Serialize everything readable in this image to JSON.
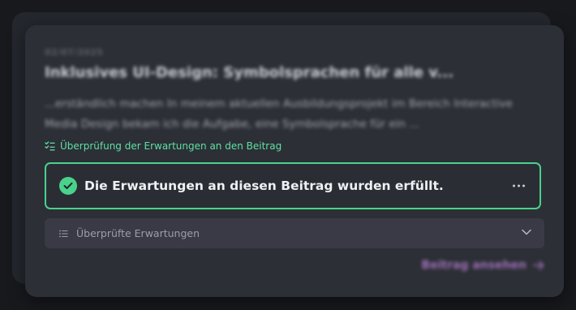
{
  "post": {
    "date": "02/07/2025",
    "title": "Inklusives UI-Design: Symbolsprachen für alle v...",
    "excerpt": "...erständlich machen In meinem aktuellen Ausbildungsprojekt im Bereich Interactive Media Design bekam ich die Aufgabe, eine Symbolsprache für ein ..."
  },
  "review": {
    "heading": "Überprüfung der Erwartungen an den Beitrag",
    "result": "Die Erwartungen an diesen Beitrag wurden erfüllt.",
    "checked_label": "Überprüfte Erwartungen"
  },
  "actions": {
    "view_post": "Beitrag ansehen"
  },
  "colors": {
    "accent_green": "#4ad28c",
    "heading_green": "#5ee0a2",
    "link_purple": "#9d6fb5"
  },
  "icons": {
    "review": "checklist-icon",
    "result": "check-circle-icon",
    "more": "more-horizontal-icon",
    "list": "list-icon",
    "expand": "chevron-down-icon",
    "link": "arrow-right-icon"
  }
}
